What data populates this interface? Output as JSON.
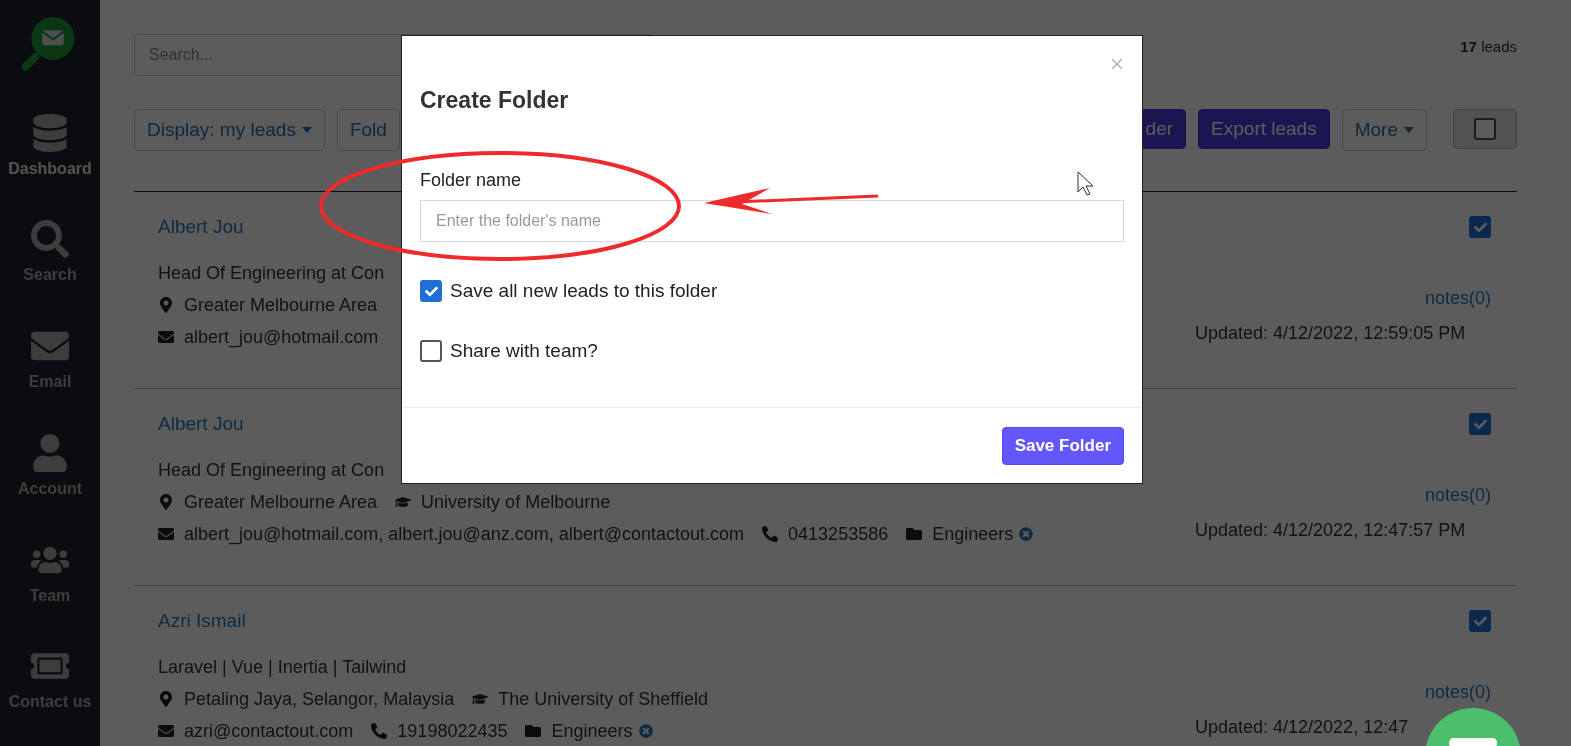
{
  "sidebar": {
    "items": [
      {
        "label": "Dashboard",
        "selected": true
      },
      {
        "label": "Search",
        "selected": false
      },
      {
        "label": "Email",
        "selected": false
      },
      {
        "label": "Account",
        "selected": false
      },
      {
        "label": "Team",
        "selected": false
      },
      {
        "label": "Contact us",
        "selected": false
      }
    ]
  },
  "search": {
    "placeholder": "Search..."
  },
  "lead_count": "**17** leads",
  "toolbar": {
    "left": [
      {
        "label": "Display: my leads",
        "kind": "dropdown"
      },
      {
        "label": "Fold",
        "kind": "outline"
      }
    ],
    "right": [
      {
        "label": "der",
        "kind": "primary"
      },
      {
        "label": "Export leads",
        "kind": "primary"
      },
      {
        "label": "More",
        "kind": "dropdown"
      },
      {
        "kind": "checkbox",
        "checked": false
      }
    ]
  },
  "leads": [
    {
      "name": "Albert Jou",
      "title": "Head Of Engineering at Con",
      "selected": true,
      "notes": "notes(0)",
      "updated": "Updated: 4/12/2022, 12:59:05 PM",
      "lines": [
        [
          {
            "kind": "location",
            "text": "Greater Melbourne Area"
          }
        ],
        [
          {
            "kind": "email",
            "text": "albert_jou@hotmail.com"
          }
        ]
      ]
    },
    {
      "name": "Albert Jou",
      "title": "Head Of Engineering at Con",
      "selected": true,
      "notes": "notes(0)",
      "updated": "Updated: 4/12/2022, 12:47:57 PM",
      "lines": [
        [
          {
            "kind": "location",
            "text": "Greater Melbourne Area"
          },
          {
            "kind": "school",
            "text": "University of Melbourne"
          }
        ],
        [
          {
            "kind": "email",
            "text": "albert_jou@hotmail.com, albert.jou@anz.com, albert@contactout.com"
          },
          {
            "kind": "phone",
            "text": "0413253586"
          },
          {
            "kind": "folder",
            "text": "Engineers"
          }
        ]
      ]
    },
    {
      "name": "Azri Ismail",
      "title": "Laravel | Vue | Inertia | Tailwind",
      "selected": true,
      "notes": "notes(0)",
      "updated": "Updated: 4/12/2022, 12:47",
      "lines": [
        [
          {
            "kind": "location",
            "text": "Petaling Jaya, Selangor, Malaysia"
          },
          {
            "kind": "school",
            "text": "The University of Sheffield"
          }
        ],
        [
          {
            "kind": "email",
            "text": "azri@contactout.com"
          },
          {
            "kind": "phone",
            "text": "19198022435"
          },
          {
            "kind": "folder",
            "text": "Engineers"
          }
        ]
      ]
    }
  ],
  "dialog": {
    "title": "Create Folder",
    "close": "×",
    "field_label": "Folder name",
    "placeholder": "Enter the folder's name",
    "options": [
      {
        "label": "Save all new leads to this folder",
        "checked": true
      },
      {
        "label": "Share with team?",
        "checked": false
      }
    ],
    "save_button": "Save Folder"
  }
}
